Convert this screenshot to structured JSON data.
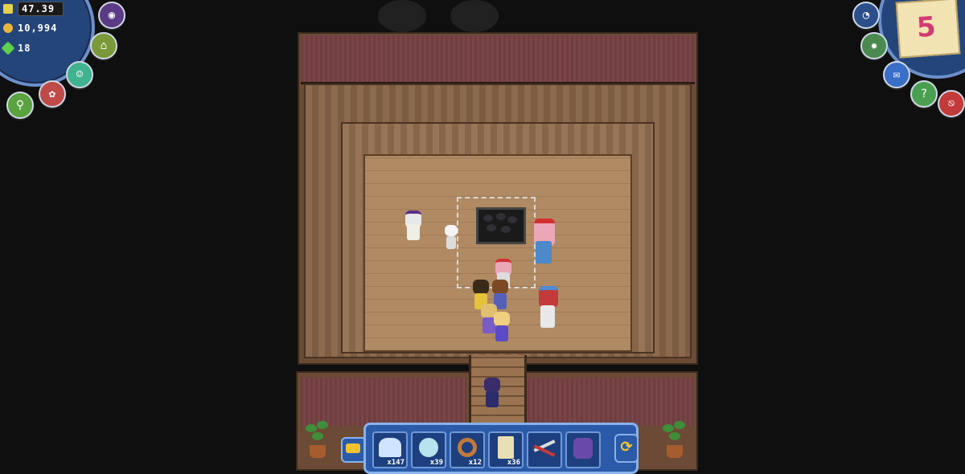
{
  "hud": {
    "energy": "47.39",
    "coins": "10,994",
    "gems": "18"
  },
  "quest": {
    "count": "5"
  },
  "left_buttons": [
    "land-icon",
    "home-icon",
    "pet-icon",
    "friends-icon",
    "map-icon"
  ],
  "right_buttons": [
    "speed-icon",
    "settings-icon",
    "mail-icon",
    "help-icon",
    "exit-icon"
  ],
  "hotbar": {
    "slots": [
      {
        "name": "wings-item",
        "count": "x147"
      },
      {
        "name": "bubble-item",
        "count": "x39"
      },
      {
        "name": "rope-item",
        "count": "x12"
      },
      {
        "name": "scroll-item",
        "count": "x36"
      },
      {
        "name": "shears-item",
        "count": ""
      },
      {
        "name": "pet-item",
        "count": ""
      }
    ]
  },
  "colors": {
    "hud_blue": "#24457a",
    "hud_rim": "#6c8fcb",
    "quest_pink": "#d33b73",
    "floor": "#b08a63",
    "wall": "#6e3e40"
  }
}
